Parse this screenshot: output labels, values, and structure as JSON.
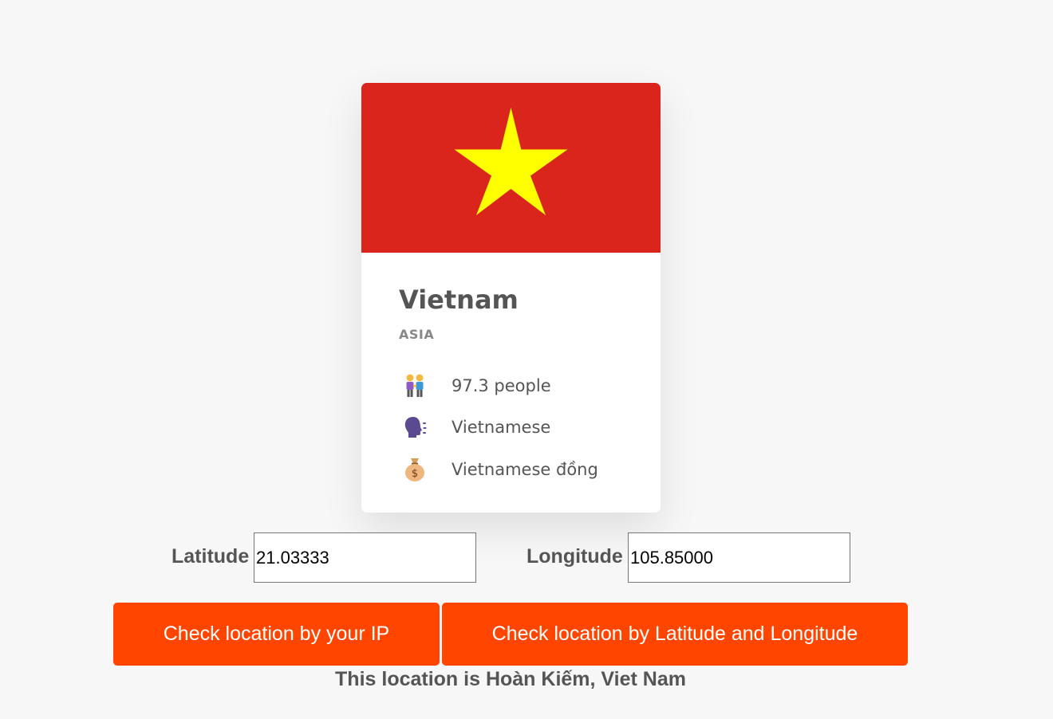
{
  "card": {
    "country_name": "Vietnam",
    "region": "ASIA",
    "flag": {
      "description_colors": {
        "field": "#da251d",
        "star": "#ffff00"
      }
    },
    "details": [
      {
        "icon": "people-holding-hands-icon",
        "text": "97.3 people"
      },
      {
        "icon": "speaking-head-icon",
        "text": "Vietnamese"
      },
      {
        "icon": "money-bag-icon",
        "text": "Vietnamese đồng"
      }
    ]
  },
  "form": {
    "latitude_label": "Latitude",
    "latitude_value": "21.03333",
    "longitude_label": "Longitude",
    "longitude_value": "105.85000"
  },
  "buttons": {
    "by_ip_label": "Check location by your IP",
    "by_coords_label": "Check location by Latitude and Longitude"
  },
  "result_text": "This location is Hoàn Kiếm, Viet Nam",
  "colors": {
    "accent": "#ff4500",
    "background": "#f7f7f7",
    "text": "#555555"
  }
}
